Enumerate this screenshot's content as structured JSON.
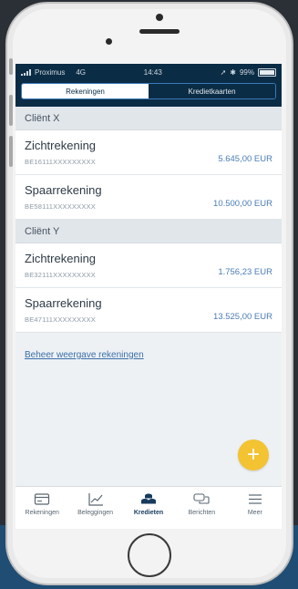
{
  "status_bar": {
    "carrier": "Proximus",
    "network": "4G",
    "time": "14:43",
    "battery": "99%"
  },
  "tabs": [
    {
      "label": "Rekeningen",
      "active": true
    },
    {
      "label": "Kredietkaarten",
      "active": false
    }
  ],
  "groups": [
    {
      "client": "Cliënt X",
      "accounts": [
        {
          "name": "Zichtrekening",
          "iban": "BE16111XXXXXXXXX",
          "amount": "5.645,00 EUR"
        },
        {
          "name": "Spaarrekening",
          "iban": "BE58111XXXXXXXXX",
          "amount": "10.500,00 EUR"
        }
      ]
    },
    {
      "client": "Cliënt Y",
      "accounts": [
        {
          "name": "Zichtrekening",
          "iban": "BE32111XXXXXXXXX",
          "amount": "1.756,23 EUR"
        },
        {
          "name": "Spaarrekening",
          "iban": "BE47111XXXXXXXXX",
          "amount": "13.525,00 EUR"
        }
      ]
    }
  ],
  "manage_link": "Beheer weergave rekeningen",
  "fab_label": "+",
  "bottom_nav": [
    {
      "label": "Rekeningen",
      "icon": "card-icon",
      "active": false
    },
    {
      "label": "Beleggingen",
      "icon": "chart-icon",
      "active": false
    },
    {
      "label": "Kredieten",
      "icon": "coins-icon",
      "active": true
    },
    {
      "label": "Berichten",
      "icon": "chat-icon",
      "active": false
    },
    {
      "label": "Meer",
      "icon": "menu-icon",
      "active": false
    }
  ],
  "colors": {
    "header_navy": "#0b2c45",
    "amount_blue": "#4a7cb6",
    "fab_yellow": "#f3c332",
    "link_blue": "#3a6fa8"
  }
}
